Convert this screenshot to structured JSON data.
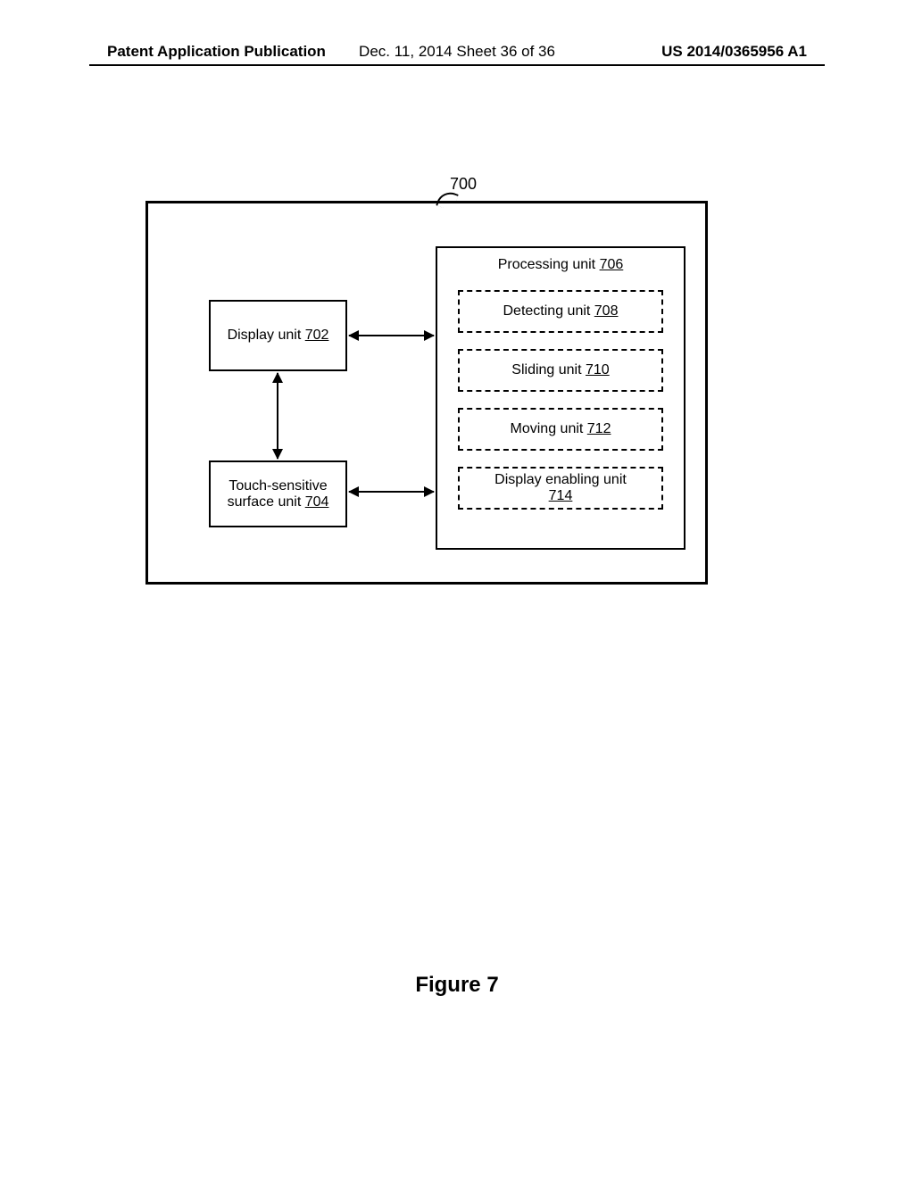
{
  "header": {
    "left": "Patent Application Publication",
    "center": "Dec. 11, 2014  Sheet 36 of 36",
    "right": "US 2014/0365956 A1"
  },
  "diagram": {
    "ref_main": "700",
    "display_unit": {
      "label": "Display unit ",
      "ref": "702"
    },
    "touch_unit": {
      "label_line1": "Touch-sensitive",
      "label_line2": "surface unit ",
      "ref": "704"
    },
    "processing_unit": {
      "label": "Processing unit ",
      "ref": "706",
      "subunits": [
        {
          "label": "Detecting unit ",
          "ref": "708"
        },
        {
          "label": "Sliding unit ",
          "ref": "710"
        },
        {
          "label": "Moving unit ",
          "ref": "712"
        },
        {
          "label": "Display enabling unit",
          "ref": "714"
        }
      ]
    }
  },
  "caption": "Figure 7"
}
